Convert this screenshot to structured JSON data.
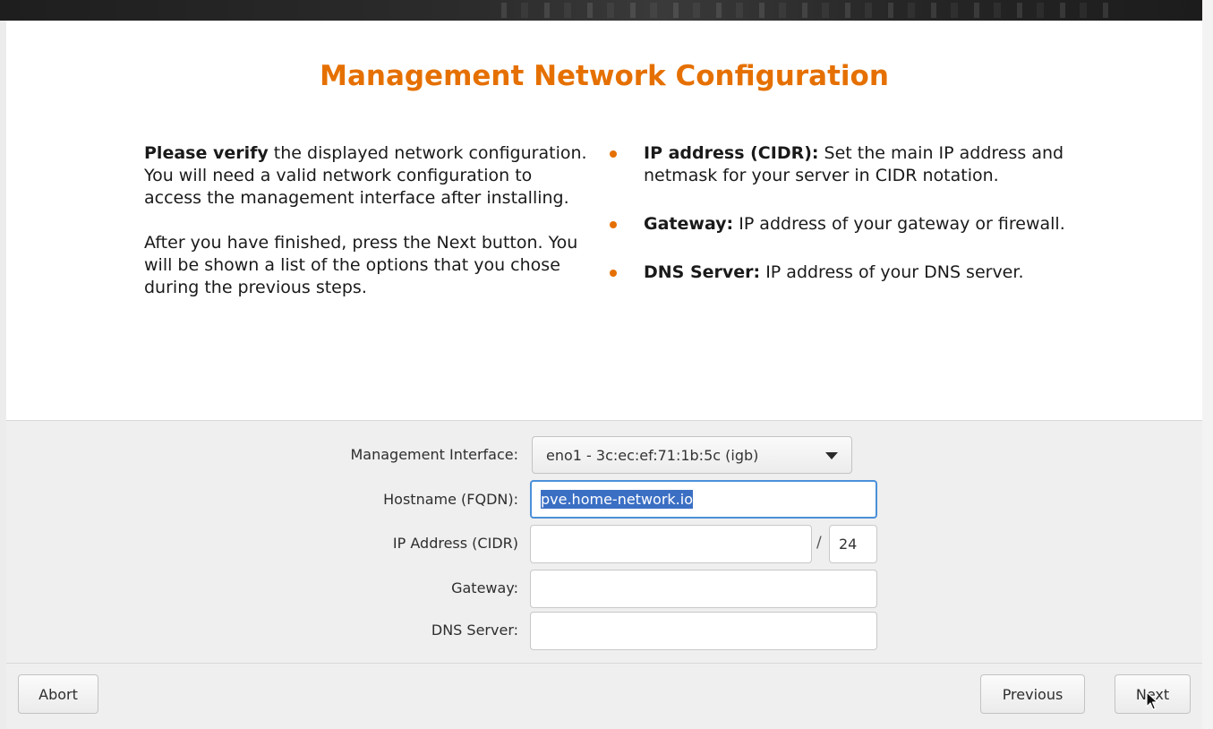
{
  "page": {
    "title": "Management Network Configuration",
    "accent_color": "#e57000"
  },
  "intro": {
    "p1_bold": "Please verify",
    "p1_rest": " the displayed network configuration. You will need a valid network configuration to access the management interface after installing.",
    "p2": "After you have finished, press the Next button. You will be shown a list of the options that you chose during the previous steps."
  },
  "help": [
    {
      "term": "IP address (CIDR):",
      "text": " Set the main IP address and netmask for your server in CIDR notation."
    },
    {
      "term": "Gateway:",
      "text": " IP address of your gateway or firewall."
    },
    {
      "term": "DNS Server:",
      "text": " IP address of your DNS server."
    }
  ],
  "form": {
    "interface_label": "Management Interface:",
    "interface_value": "eno1 - 3c:ec:ef:71:1b:5c (igb)",
    "hostname_label": "Hostname (FQDN):",
    "hostname_value": "pve.home-network.io",
    "ip_label": "IP Address (CIDR)",
    "ip_value": "",
    "cidr_separator": "/",
    "cidr_value": "24",
    "gateway_label": "Gateway:",
    "gateway_value": "",
    "dns_label": "DNS Server:",
    "dns_value": ""
  },
  "buttons": {
    "abort": "Abort",
    "previous": "Previous",
    "next": "Next"
  }
}
